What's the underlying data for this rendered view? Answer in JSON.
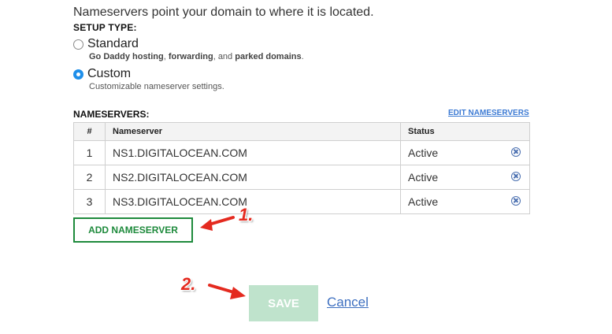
{
  "intro_text": "Nameservers point your domain to where it is located.",
  "setup": {
    "label": "SETUP TYPE:",
    "standard": {
      "label": "Standard",
      "desc_part1": "Go Daddy hosting",
      "desc_sep1": ", ",
      "desc_part2": "forwarding",
      "desc_sep2": ", and ",
      "desc_part3": "parked domains",
      "desc_end": ".",
      "selected": false
    },
    "custom": {
      "label": "Custom",
      "desc": "Customizable nameserver settings.",
      "selected": true
    }
  },
  "nameservers": {
    "label": "NAMESERVERS:",
    "edit_link": "EDIT NAMESERVERS",
    "columns": [
      "#",
      "Nameserver",
      "Status"
    ],
    "rows": [
      {
        "num": "1",
        "server": "NS1.DIGITALOCEAN.COM",
        "status": "Active",
        "remove_icon": "circle-x-icon"
      },
      {
        "num": "2",
        "server": "NS2.DIGITALOCEAN.COM",
        "status": "Active",
        "remove_icon": "circle-x-icon"
      },
      {
        "num": "3",
        "server": "NS3.DIGITALOCEAN.COM",
        "status": "Active",
        "remove_icon": "circle-x-icon"
      }
    ]
  },
  "actions": {
    "add_label": "ADD NAMESERVER",
    "save_label": "SAVE",
    "cancel_label": "Cancel"
  },
  "annotations": {
    "step1": "1.",
    "step2": "2.",
    "color": "#e42a1f"
  },
  "colors": {
    "accent_green": "#1e8a3c",
    "save_disabled": "#bfe3cc",
    "link_blue": "#3d7bd4",
    "radio_checked": "#1f8fea"
  }
}
